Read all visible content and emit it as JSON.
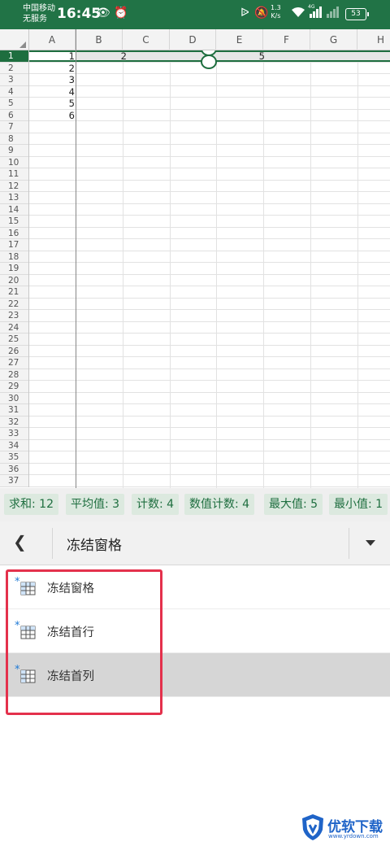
{
  "status_bar": {
    "carrier_line1": "中国移动",
    "carrier_line2": "无服务",
    "time": "16:45",
    "net_speed_value": "1.3",
    "net_speed_unit": "K/s",
    "signal_label": "4G",
    "battery": "53"
  },
  "sheet": {
    "columns": [
      "A",
      "B",
      "C",
      "D",
      "E",
      "F",
      "G",
      "H"
    ],
    "rows": [
      "1",
      "2",
      "3",
      "4",
      "5",
      "6",
      "7",
      "8",
      "9",
      "10",
      "11",
      "12",
      "13",
      "14",
      "15",
      "16",
      "17",
      "18",
      "19",
      "20",
      "21",
      "22",
      "23",
      "24",
      "25",
      "26",
      "27",
      "28",
      "29",
      "30",
      "31",
      "32",
      "33",
      "34",
      "35",
      "36",
      "37"
    ],
    "column_a_values": [
      "1",
      "2",
      "3",
      "4",
      "5",
      "6"
    ],
    "row1_b_value": "2",
    "row1_e_value": "5"
  },
  "stats": {
    "sum": "求和: 12",
    "average": "平均值: 3",
    "count": "计数: 4",
    "numeric_count": "数值计数: 4",
    "max": "最大值: 5",
    "min": "最小值: 1"
  },
  "toolbar": {
    "back_icon": "chevron-left-icon",
    "title": "冻结窗格",
    "dropdown_icon": "dropdown-triangle-icon"
  },
  "menu": {
    "items": [
      {
        "label": "冻结窗格",
        "icon": "freeze-panes-icon"
      },
      {
        "label": "冻结首行",
        "icon": "freeze-top-row-icon"
      },
      {
        "label": "冻结首列",
        "icon": "freeze-first-column-icon"
      }
    ],
    "selected_index": 2
  },
  "watermark": {
    "title": "优软下载",
    "url": "www.yrdown.com"
  },
  "colors": {
    "brand_green": "#217346",
    "highlight_red": "#e4314c",
    "icon_blue": "#1f7ad6"
  }
}
